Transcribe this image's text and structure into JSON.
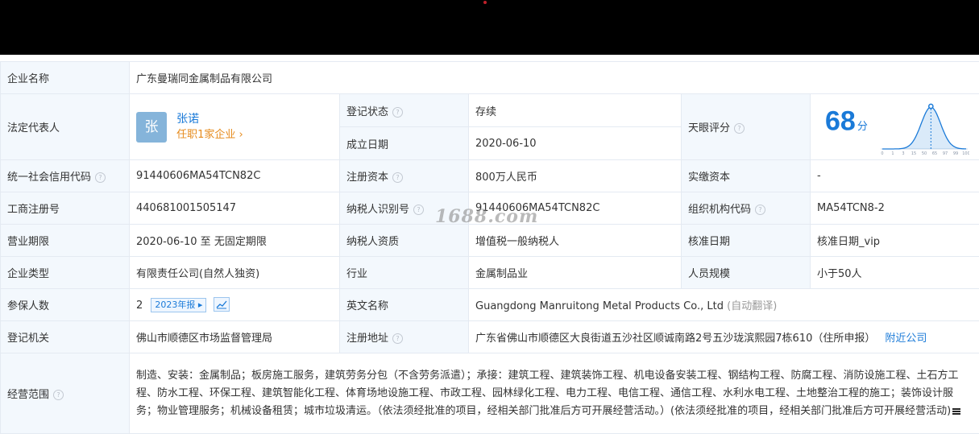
{
  "company": {
    "name_label": "企业名称",
    "name": "广东曼瑞同金属制品有限公司"
  },
  "legal": {
    "label": "法定代表人",
    "avatar": "张",
    "name": "张诺",
    "position": "任职1家企业"
  },
  "status": {
    "label": "登记状态",
    "value": "存续"
  },
  "founded": {
    "label": "成立日期",
    "value": "2020-06-10"
  },
  "tianyan": {
    "label": "天眼评分",
    "score": "68",
    "unit": "分",
    "axis": [
      "0",
      "1",
      "3",
      "15",
      "50",
      "65",
      "97",
      "99",
      "100"
    ],
    "marker_fraction": 0.58,
    "color": "#1a7ad8"
  },
  "credit_code": {
    "label": "统一社会信用代码",
    "value": "91440606MA54TCN82C"
  },
  "reg_capital": {
    "label": "注册资本",
    "value": "800万人民币"
  },
  "paid_capital": {
    "label": "实缴资本",
    "value": "-"
  },
  "reg_no": {
    "label": "工商注册号",
    "value": "440681001505147"
  },
  "taxpayer_id": {
    "label": "纳税人识别号",
    "value": "91440606MA54TCN82C"
  },
  "org_code": {
    "label": "组织机构代码",
    "value": "MA54TCN8-2"
  },
  "term": {
    "label": "营业期限",
    "value": "2020-06-10 至 无固定期限"
  },
  "tax_qual": {
    "label": "纳税人资质",
    "value": "增值税一般纳税人"
  },
  "approve_date": {
    "label": "核准日期",
    "value": "核准日期_vip"
  },
  "type": {
    "label": "企业类型",
    "value": "有限责任公司(自然人独资)"
  },
  "industry": {
    "label": "行业",
    "value": "金属制品业"
  },
  "staff": {
    "label": "人员规模",
    "value": "小于50人"
  },
  "insured": {
    "label": "参保人数",
    "value": "2",
    "report": "2023年报"
  },
  "english": {
    "label": "英文名称",
    "value": "Guangdong Manruitong Metal Products Co., Ltd",
    "note": "(自动翻译)"
  },
  "authority": {
    "label": "登记机关",
    "value": "佛山市顺德区市场监督管理局"
  },
  "address": {
    "label": "注册地址",
    "value": "广东省佛山市顺德区大良街道五沙社区顺诚南路2号五沙珑滨熙园7栋610（住所申报）",
    "link": "附近公司"
  },
  "scope": {
    "label": "经营范围",
    "value": "制造、安装：金属制品；板房施工服务，建筑劳务分包（不含劳务派遣）；承接：建筑工程、建筑装饰工程、机电设备安装工程、钢结构工程、防腐工程、消防设施工程、土石方工程、防水工程、环保工程、建筑智能化工程、体育场地设施工程、市政工程、园林绿化工程、电力工程、电信工程、通信工程、水利水电工程、土地整治工程的施工；装饰设计服务；物业管理服务；机械设备租赁；城市垃圾清运。（依法须经批准的项目，经相关部门批准后方可开展经营活动。）(依法须经批准的项目，经相关部门批准后方可开展经营活动)"
  },
  "watermark": "1688.com"
}
